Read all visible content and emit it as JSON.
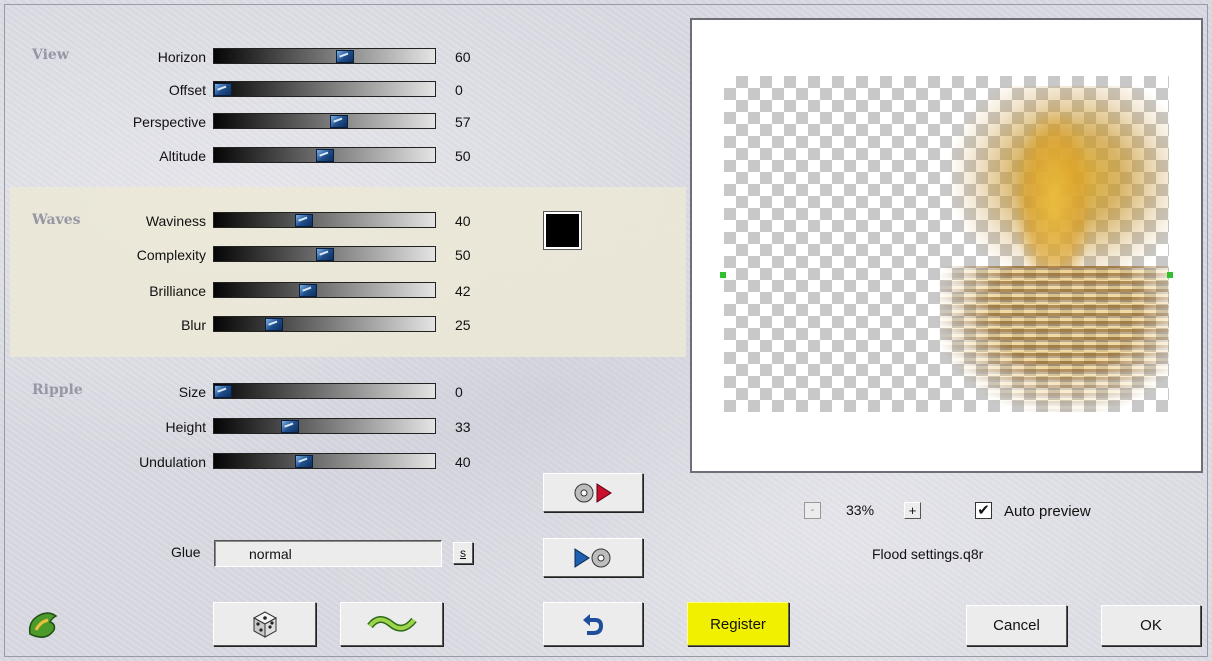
{
  "sections": {
    "view": "View",
    "waves": "Waves",
    "ripple": "Ripple"
  },
  "sliders": [
    {
      "label": "Horizon",
      "value": "60",
      "level": 60
    },
    {
      "label": "Offset",
      "value": "0",
      "level": 0
    },
    {
      "label": "Perspective",
      "value": "57",
      "level": 57
    },
    {
      "label": "Altitude",
      "value": "50",
      "level": 50
    },
    {
      "label": "Waviness",
      "value": "40",
      "level": 40
    },
    {
      "label": "Complexity",
      "value": "50",
      "level": 50
    },
    {
      "label": "Brilliance",
      "value": "42",
      "level": 42
    },
    {
      "label": "Blur",
      "value": "25",
      "level": 25
    },
    {
      "label": "Size",
      "value": "0",
      "level": 0
    },
    {
      "label": "Height",
      "value": "33",
      "level": 33
    },
    {
      "label": "Undulation",
      "value": "40",
      "level": 40
    }
  ],
  "wave_color": "#000000",
  "glue": {
    "label": "Glue",
    "value": "normal",
    "options_button": "s"
  },
  "preview": {
    "zoom_minus": "-",
    "zoom": "33%",
    "zoom_plus": "+",
    "auto_preview_label": "Auto preview",
    "auto_preview_checked": true,
    "check_mark": "✔",
    "settings_file": "Flood settings.q8r"
  },
  "buttons": {
    "register": "Register",
    "cancel": "Cancel",
    "ok": "OK"
  },
  "icons": {
    "logo": "flood-logo-icon",
    "random": "dice-icon",
    "reset": "wave-icon",
    "undo": "undo-arrow-icon",
    "load": "load-settings-icon",
    "save": "save-settings-icon"
  }
}
